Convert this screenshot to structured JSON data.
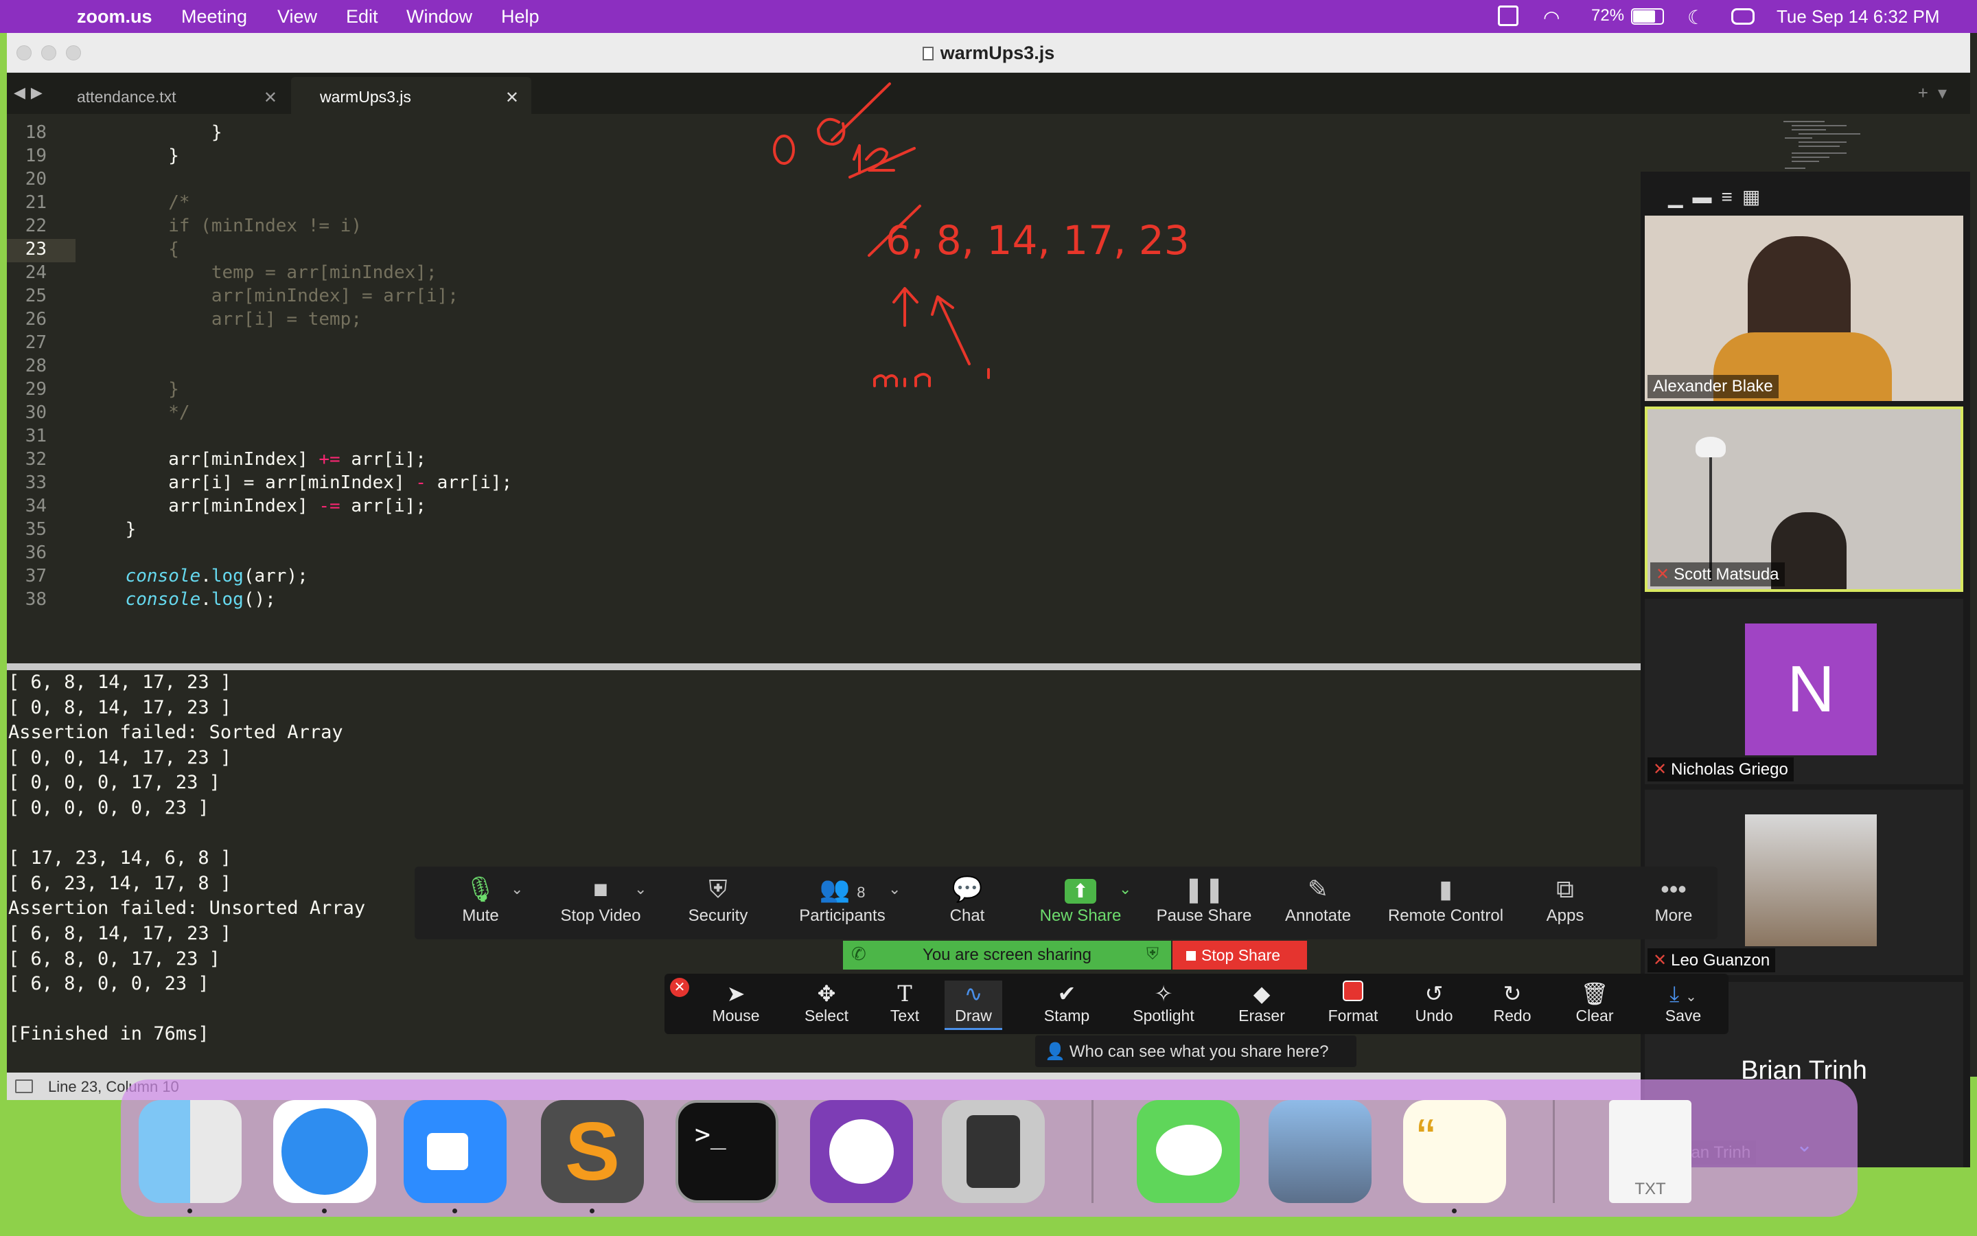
{
  "menubar": {
    "app": "zoom.us",
    "items": [
      "Meeting",
      "View",
      "Edit",
      "Window",
      "Help"
    ],
    "battery": "72%",
    "datetime": "Tue Sep 14  6:32 PM"
  },
  "window": {
    "title": "warmUps3.js",
    "tabs": [
      {
        "label": "attendance.txt",
        "active": false
      },
      {
        "label": "warmUps3.js",
        "active": true
      }
    ]
  },
  "editor": {
    "current_line": "23",
    "lines": [
      {
        "n": "18",
        "t": "            }"
      },
      {
        "n": "19",
        "t": "        }"
      },
      {
        "n": "20",
        "t": ""
      },
      {
        "n": "21",
        "t": "        /*"
      },
      {
        "n": "22",
        "t": "        if (minIndex != i)"
      },
      {
        "n": "23",
        "t": "        {"
      },
      {
        "n": "24",
        "t": "            temp = arr[minIndex];"
      },
      {
        "n": "25",
        "t": "            arr[minIndex] = arr[i];"
      },
      {
        "n": "26",
        "t": "            arr[i] = temp;"
      },
      {
        "n": "27",
        "t": ""
      },
      {
        "n": "28",
        "t": ""
      },
      {
        "n": "29",
        "t": "        }"
      },
      {
        "n": "30",
        "t": "        */"
      },
      {
        "n": "31",
        "t": ""
      },
      {
        "n": "32",
        "a": "        arr[minIndex] ",
        "op": "+=",
        "b": " arr[i];"
      },
      {
        "n": "33",
        "a": "        arr[i] = arr[minIndex] ",
        "op": "-",
        "b": " arr[i];"
      },
      {
        "n": "34",
        "a": "        arr[minIndex] ",
        "op": "-=",
        "b": " arr[i];"
      },
      {
        "n": "35",
        "t": "    }"
      },
      {
        "n": "36",
        "t": ""
      },
      {
        "n": "37",
        "obj": "    console",
        "dot": ".",
        "fn": "log",
        "rest": "(arr);"
      },
      {
        "n": "38",
        "obj": "    console",
        "dot": ".",
        "fn": "log",
        "rest": "();"
      }
    ]
  },
  "output": {
    "lines": [
      "[ 6, 8, 14, 17, 23 ]",
      "[ 0, 8, 14, 17, 23 ]",
      "Assertion failed: Sorted Array",
      "[ 0, 0, 14, 17, 23 ]",
      "[ 0, 0, 0, 17, 23 ]",
      "[ 0, 0, 0, 0, 23 ]",
      "",
      "[ 17, 23, 14, 6, 8 ]",
      "[ 6, 23, 14, 17, 8 ]",
      "Assertion failed: Unsorted Array",
      "[ 6, 8, 14, 17, 23 ]",
      "[ 6, 8, 0, 17, 23 ]",
      "[ 6, 8, 0, 0, 23 ]",
      "",
      "[Finished in 76ms]"
    ]
  },
  "status": {
    "position": "Line 23, Column 10"
  },
  "annotations": {
    "zero": "0",
    "sequence": "6, 8, 14, 17, 23",
    "min": "min",
    "color": "#e8362a"
  },
  "participants": [
    {
      "name": "Alexander Blake",
      "muted": false
    },
    {
      "name": "Scott Matsuda",
      "muted": true
    },
    {
      "name": "Nicholas Griego",
      "muted": true,
      "initial": "N"
    },
    {
      "name": "Leo Guanzon",
      "muted": true
    },
    {
      "name": "Brian Trinh",
      "muted": true
    }
  ],
  "zoom_toolbar": {
    "mute": "Mute",
    "stop_video": "Stop Video",
    "security": "Security",
    "participants": "Participants",
    "participant_count": "8",
    "chat": "Chat",
    "new_share": "New Share",
    "pause_share": "Pause Share",
    "annotate": "Annotate",
    "remote_control": "Remote Control",
    "apps": "Apps",
    "more": "More"
  },
  "share": {
    "banner": "You are screen sharing",
    "stop": "Stop Share",
    "who_can_see": "Who can see what you share here?"
  },
  "annotate_toolbar": {
    "mouse": "Mouse",
    "select": "Select",
    "text": "Text",
    "draw": "Draw",
    "stamp": "Stamp",
    "spotlight": "Spotlight",
    "eraser": "Eraser",
    "format": "Format",
    "undo": "Undo",
    "redo": "Redo",
    "clear": "Clear",
    "save": "Save"
  },
  "dock": {
    "txt_label": "TXT"
  }
}
